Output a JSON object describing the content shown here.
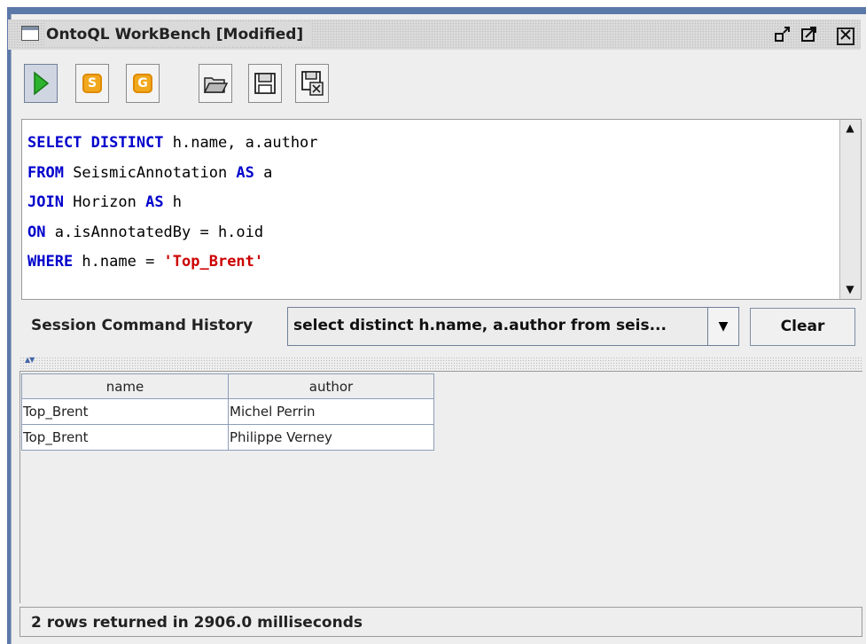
{
  "window": {
    "title": "OntoQL WorkBench [Modified]",
    "controls": [
      "restore-icon",
      "maximize-icon",
      "close-icon"
    ]
  },
  "toolbar": {
    "buttons": [
      {
        "name": "run",
        "icon": "play-icon"
      },
      {
        "name": "s",
        "icon": "s-badge-icon",
        "label": "S"
      },
      {
        "name": "g",
        "icon": "g-badge-icon",
        "label": "G"
      },
      {
        "name": "open",
        "icon": "folder-open-icon"
      },
      {
        "name": "save",
        "icon": "floppy-icon"
      },
      {
        "name": "export",
        "icon": "floppy-export-icon"
      }
    ]
  },
  "editor": {
    "lines": [
      [
        {
          "t": "SELECT DISTINCT",
          "k": "kw"
        },
        {
          "t": " h.name, a.author",
          "k": ""
        }
      ],
      [
        {
          "t": "FROM",
          "k": "kw"
        },
        {
          "t": " SeismicAnnotation ",
          "k": ""
        },
        {
          "t": "AS",
          "k": "kw"
        },
        {
          "t": " a",
          "k": ""
        }
      ],
      [
        {
          "t": "JOIN",
          "k": "kw"
        },
        {
          "t": " Horizon ",
          "k": ""
        },
        {
          "t": "AS",
          "k": "kw"
        },
        {
          "t": " h",
          "k": ""
        }
      ],
      [
        {
          "t": "ON",
          "k": "kw"
        },
        {
          "t": " a.isAnnotatedBy = h.oid",
          "k": ""
        }
      ],
      [
        {
          "t": "WHERE",
          "k": "kw"
        },
        {
          "t": " h.name = ",
          "k": ""
        },
        {
          "t": "'Top_Brent'",
          "k": "str"
        }
      ]
    ]
  },
  "history": {
    "label": "Session Command History",
    "selected": "select distinct h.name, a.author from seis...",
    "clear_label": "Clear"
  },
  "results": {
    "columns": [
      "name",
      "author"
    ],
    "rows": [
      [
        "Top_Brent",
        "Michel Perrin"
      ],
      [
        "Top_Brent",
        "Philippe Verney"
      ]
    ]
  },
  "status": {
    "text": "2 rows returned in 2906.0 milliseconds"
  },
  "colors": {
    "keyword": "#0000cc",
    "string": "#cc0000",
    "frame": "#5b79a8",
    "badge": "#f1a81c"
  }
}
